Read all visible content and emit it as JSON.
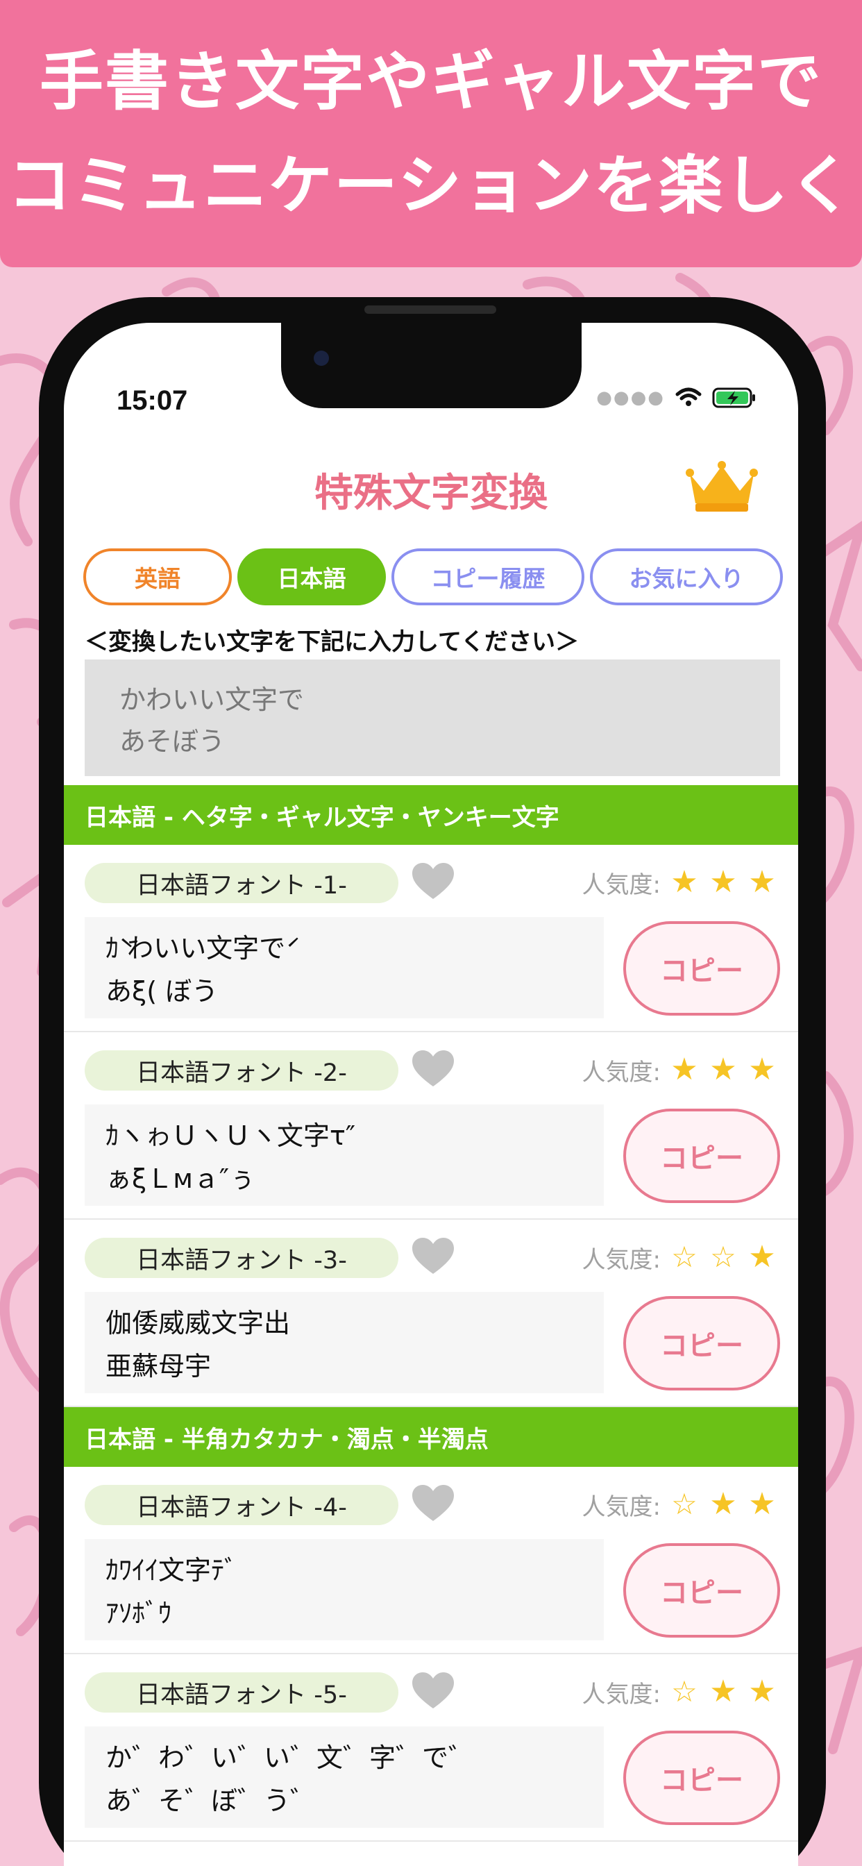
{
  "banner": {
    "line1": "手書き文字やギャル文字で",
    "line2": "コミュニケーションを楽しく"
  },
  "status_bar": {
    "time": "15:07"
  },
  "nav": {
    "title": "特殊文字変換",
    "premium_icon": "crown-icon"
  },
  "tabs": [
    {
      "label": "英語",
      "selected": false
    },
    {
      "label": "日本語",
      "selected": true
    },
    {
      "label": "コピー履歴",
      "selected": false
    },
    {
      "label": "お気に入り",
      "selected": false
    }
  ],
  "prompt": "＜変換したい文字を下記に入力してください＞",
  "input": {
    "value": "かわいい文字で\nあそぼう"
  },
  "sections": [
    {
      "title": "日本語 - ヘタ字・ギャル文字・ヤンキー文字"
    },
    {
      "title": "日本語 - 半角カタカナ・濁点・半濁点"
    }
  ],
  "popularity_label": "人気度:",
  "copy_label": "コピー",
  "fonts": [
    {
      "name": "日本語フォント -1-",
      "sample": "ｶ̀ わいい文字で́\nあξ( ぼう",
      "stars": 3
    },
    {
      "name": "日本語フォント -2-",
      "sample": "ｶヽゎＵヽＵヽ文字τ″\nぁξＬмａ″ぅ",
      "stars": 3
    },
    {
      "name": "日本語フォント -3-",
      "sample": "伽倭威威文字出\n亜蘇母宇",
      "stars": 1
    },
    {
      "name": "日本語フォント -4-",
      "sample": "ｶﾜｲｲ文字ﾃﾞ\nｱｿﾎﾞｳ",
      "stars": 2
    },
    {
      "name": "日本語フォント -5-",
      "sample": "か゛わ゛い゛い゛文゛字゛で゛\nあ゛そ゛ぼ゛う゛",
      "stars": 2
    }
  ],
  "colors": {
    "banner": "#f1729c",
    "title": "#ea6f86",
    "section": "#6bc116",
    "english_tab": "#f0842a",
    "outline_tab": "#8a8ff0",
    "copy_button": "#e8798f",
    "star": "#f6c425"
  }
}
